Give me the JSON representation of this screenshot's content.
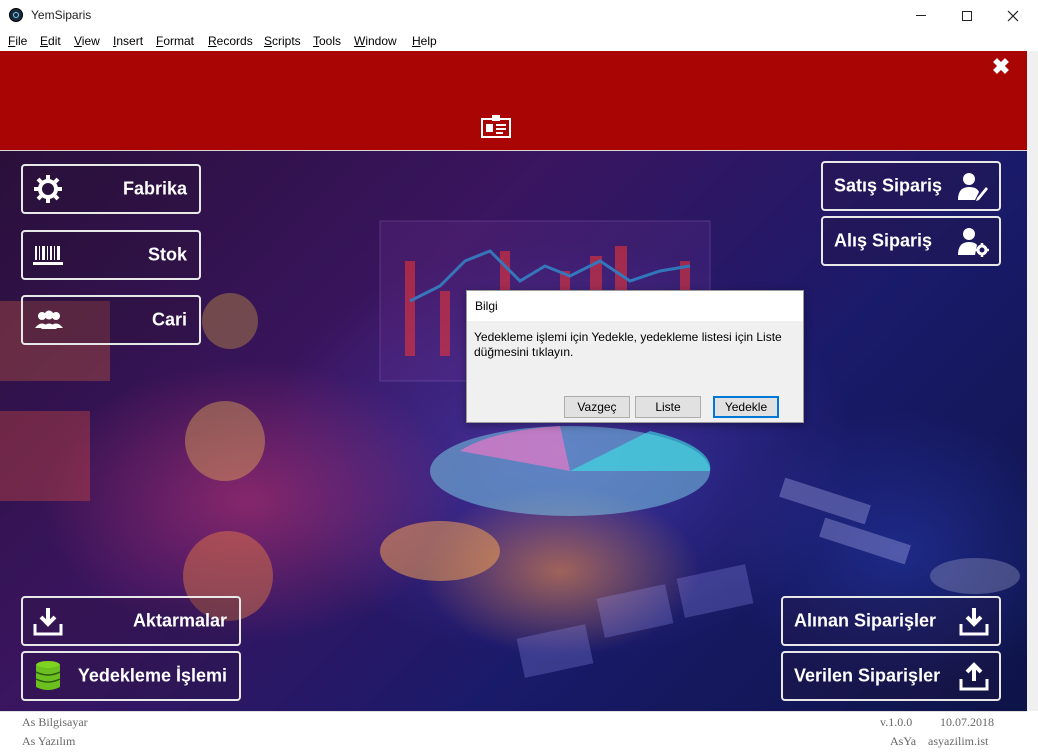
{
  "window": {
    "title": "YemSiparis",
    "controls": {
      "minimize": "minimize-icon",
      "maximize": "maximize-icon",
      "close": "close-icon"
    }
  },
  "menu": [
    "File",
    "Edit",
    "View",
    "Insert",
    "Format",
    "Records",
    "Scripts",
    "Tools",
    "Window",
    "Help"
  ],
  "header": {
    "close_symbol": "✖",
    "icon": "id-card-icon",
    "color": "#a90505"
  },
  "left_buttons": {
    "fabrika": {
      "label": "Fabrika",
      "icon": "gear-icon"
    },
    "stok": {
      "label": "Stok",
      "icon": "barcode-icon"
    },
    "cari": {
      "label": "Cari",
      "icon": "users-icon"
    },
    "aktarmalar": {
      "label": "Aktarmalar",
      "icon": "download-icon"
    },
    "yedekleme": {
      "label": "Yedekleme İşlemi",
      "icon": "database-icon"
    }
  },
  "right_buttons": {
    "satis": {
      "label": "Satış Sipariş",
      "icon": "user-edit-icon"
    },
    "alis": {
      "label": "Alış Sipariş",
      "icon": "user-settings-icon"
    },
    "alinan": {
      "label": "Alınan Siparişler",
      "icon": "download-icon"
    },
    "verilen": {
      "label": "Verilen Siparişler",
      "icon": "upload-icon"
    }
  },
  "status": {
    "left1": "As Bilgisayar",
    "left2": "As Yazılım",
    "version": "v.1.0.0",
    "date": "10.07.2018",
    "brand": "AsYa",
    "site": "asyazilim.ist"
  },
  "dialog": {
    "title": "Bilgi",
    "message": "Yedekleme işlemi için Yedekle, yedekleme listesi için Liste düğmesini tıklayın.",
    "buttons": {
      "cancel": "Vazgeç",
      "list": "Liste",
      "backup": "Yedekle"
    }
  }
}
